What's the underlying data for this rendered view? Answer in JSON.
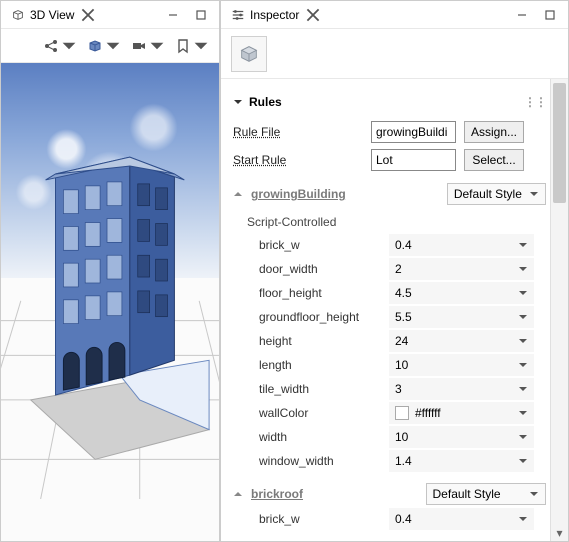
{
  "panels": {
    "left": {
      "title": "3D View"
    },
    "right": {
      "title": "Inspector"
    }
  },
  "rules_section": {
    "title": "Rules",
    "rule_file": {
      "label": "Rule File",
      "value": "growingBuildi",
      "button": "Assign..."
    },
    "start_rule": {
      "label": "Start Rule",
      "value": "Lot",
      "button": "Select..."
    }
  },
  "groups": [
    {
      "name": "growingBuilding",
      "style": "Default Style",
      "sub_label": "Script-Controlled",
      "params": [
        {
          "name": "brick_w",
          "value": "0.4"
        },
        {
          "name": "door_width",
          "value": "2"
        },
        {
          "name": "floor_height",
          "value": "4.5"
        },
        {
          "name": "groundfloor_height",
          "value": "5.5"
        },
        {
          "name": "height",
          "value": "24"
        },
        {
          "name": "length",
          "value": "10"
        },
        {
          "name": "tile_width",
          "value": "3"
        },
        {
          "name": "wallColor",
          "value": "#ffffff",
          "is_color": true
        },
        {
          "name": "width",
          "value": "10"
        },
        {
          "name": "window_width",
          "value": "1.4"
        }
      ]
    },
    {
      "name": "brickroof",
      "style": "Default Style",
      "params": [
        {
          "name": "brick_w",
          "value": "0.4"
        }
      ]
    }
  ]
}
